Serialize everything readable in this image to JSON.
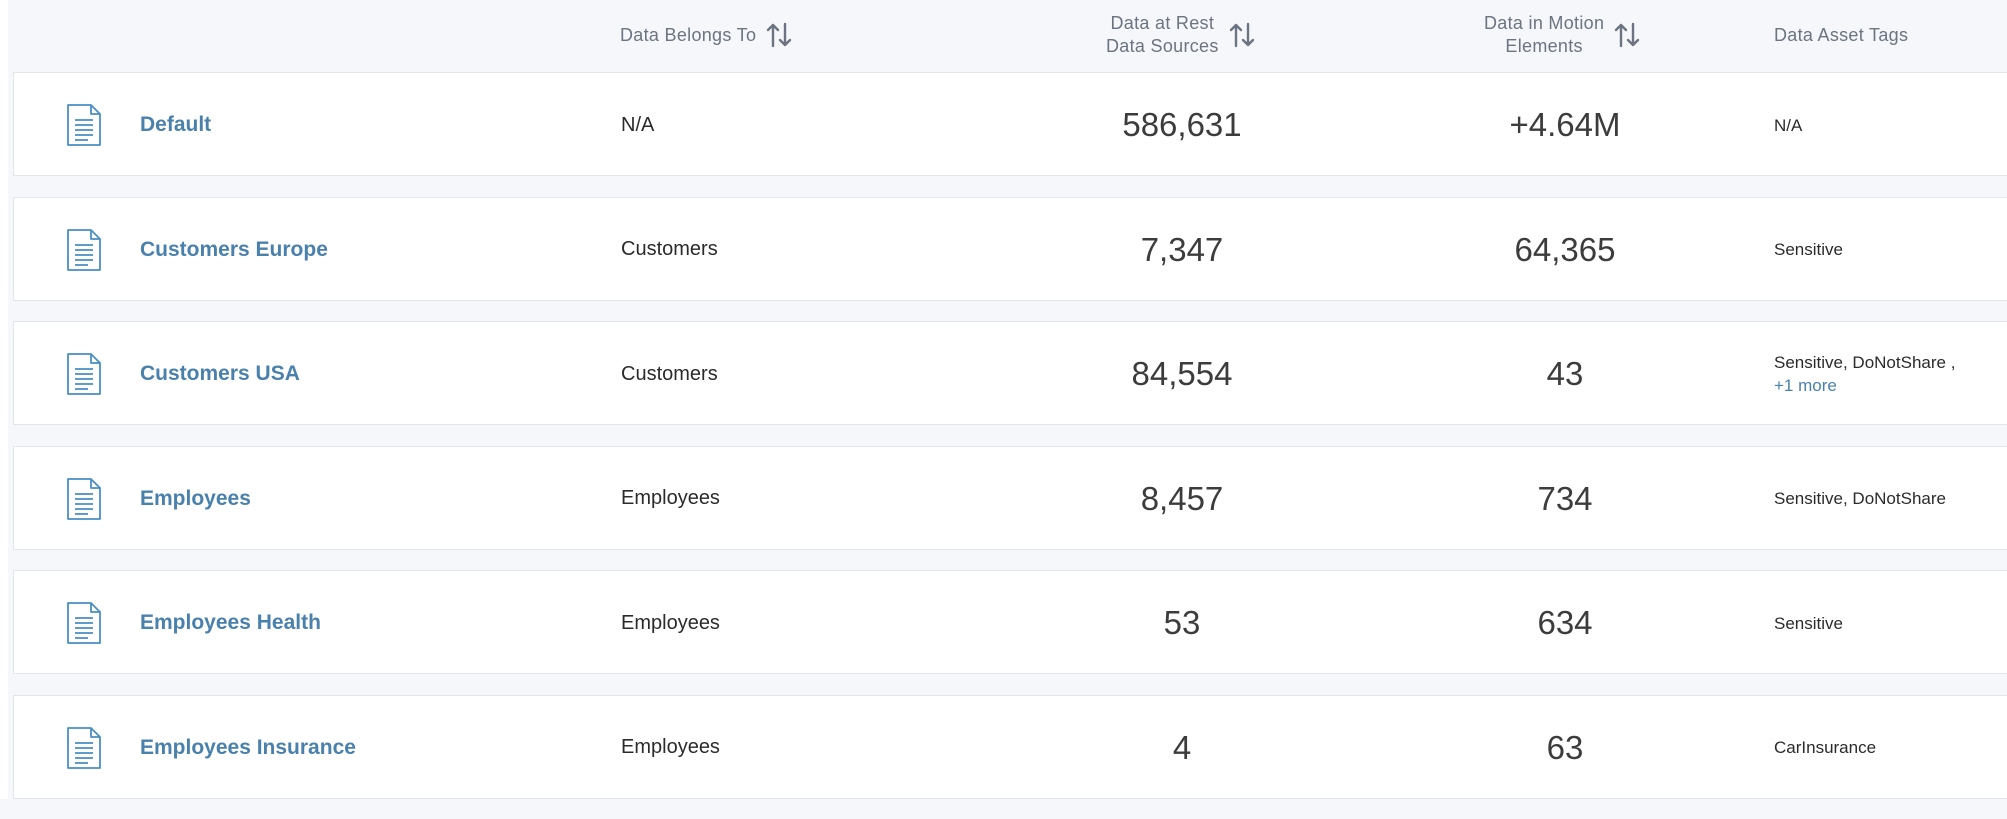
{
  "header": {
    "belongs_to": "Data Belongs To",
    "at_rest_line1": "Data at Rest",
    "at_rest_line2": "Data Sources",
    "in_motion_line1": "Data in Motion",
    "in_motion_line2": "Elements",
    "tags": "Data Asset Tags"
  },
  "icons": {
    "row_icon": "document-icon",
    "sort_icon": "sort-arrows-icon"
  },
  "colors": {
    "link": "#4a81ac",
    "icon": "#4a8fc4",
    "background": "#f5f7fa"
  },
  "rows": [
    {
      "name": "Default",
      "belongs_to": "N/A",
      "at_rest": "586,631",
      "in_motion": "+4.64M",
      "tags": "N/A",
      "more": ""
    },
    {
      "name": "Customers Europe",
      "belongs_to": "Customers",
      "at_rest": "7,347",
      "in_motion": "64,365",
      "tags": "Sensitive",
      "more": ""
    },
    {
      "name": "Customers USA",
      "belongs_to": "Customers",
      "at_rest": "84,554",
      "in_motion": "43",
      "tags": "Sensitive, DoNotShare ,",
      "more": "+1 more"
    },
    {
      "name": "Employees",
      "belongs_to": "Employees",
      "at_rest": "8,457",
      "in_motion": "734",
      "tags": "Sensitive, DoNotShare",
      "more": ""
    },
    {
      "name": "Employees Health",
      "belongs_to": "Employees",
      "at_rest": "53",
      "in_motion": "634",
      "tags": "Sensitive",
      "more": ""
    },
    {
      "name": "Employees Insurance",
      "belongs_to": "Employees",
      "at_rest": "4",
      "in_motion": "63",
      "tags": "CarInsurance",
      "more": ""
    }
  ]
}
